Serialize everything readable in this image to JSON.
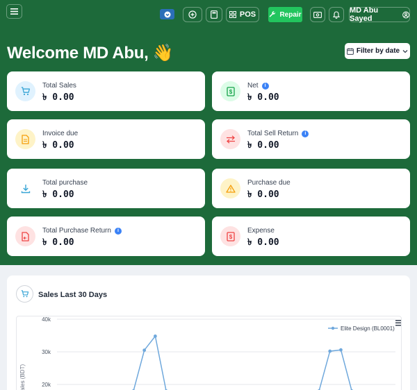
{
  "header": {
    "pos_label": "POS",
    "repair_label": "Repair",
    "user_name": "MD Abu Sayed"
  },
  "hero": {
    "welcome": "Welcome MD Abu, 👋",
    "filter_label": "Filter by date"
  },
  "cards": [
    {
      "label": "Total Sales",
      "value": "৳ 0.00",
      "icon": "cart-icon",
      "info": false
    },
    {
      "label": "Net",
      "value": "৳ 0.00",
      "icon": "money-icon",
      "info": true
    },
    {
      "label": "Invoice due",
      "value": "৳ 0.00",
      "icon": "document-icon",
      "info": false
    },
    {
      "label": "Total Sell Return",
      "value": "৳ 0.00",
      "icon": "exchange-icon",
      "info": true
    },
    {
      "label": "Total purchase",
      "value": "৳ 0.00",
      "icon": "download-icon",
      "info": false
    },
    {
      "label": "Purchase due",
      "value": "৳ 0.00",
      "icon": "warning-icon",
      "info": false
    },
    {
      "label": "Total Purchase Return",
      "value": "৳ 0.00",
      "icon": "return-icon",
      "info": true
    },
    {
      "label": "Expense",
      "value": "৳ 0.00",
      "icon": "money-icon",
      "info": false
    }
  ],
  "sales_panel": {
    "title": "Sales Last 30 Days"
  },
  "chart_data": {
    "type": "line",
    "ylabel": "ales (BDT)",
    "yticks": [
      "40k",
      "30k",
      "20k"
    ],
    "ylim": [
      20000,
      40000
    ],
    "series": [
      {
        "name": "Elite Design (BL0001)",
        "x": [
          7,
          8,
          9,
          10,
          24,
          25,
          26,
          27
        ],
        "values": [
          18000,
          30500,
          34800,
          18000,
          18000,
          30200,
          30600,
          18000
        ]
      }
    ],
    "x_range": [
      0,
      31
    ],
    "grid": true,
    "legend": "top-right",
    "color": "#6fa8dc"
  },
  "colors": {
    "brand_green": "#1d6a3a",
    "accent_green": "#22c55e",
    "accent_blue": "#2b6fb8"
  }
}
